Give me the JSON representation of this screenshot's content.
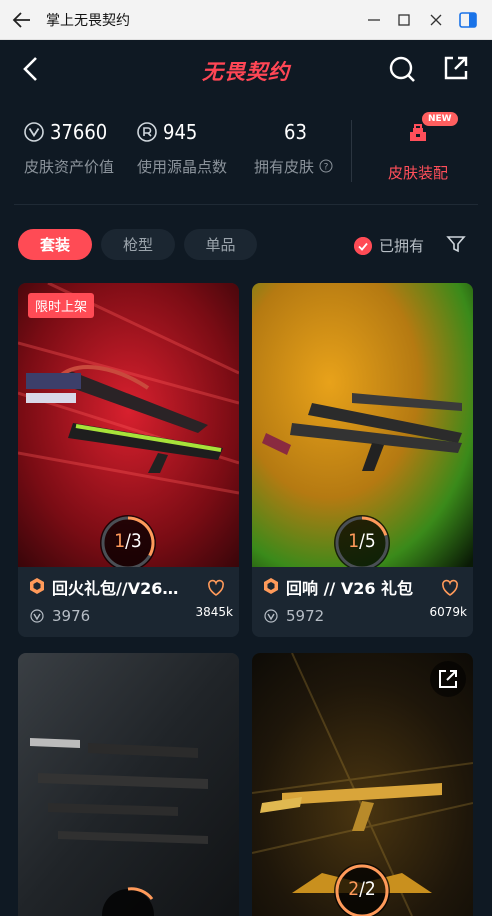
{
  "window": {
    "title": "掌上无畏契约"
  },
  "header": {
    "logo_text": "无畏契约"
  },
  "stats": [
    {
      "value": "37660",
      "label": "皮肤资产价值"
    },
    {
      "value": "945",
      "label": "使用源晶点数"
    },
    {
      "value": "63",
      "label": "拥有皮肤"
    }
  ],
  "equip": {
    "label": "皮肤装配",
    "badge": "NEW"
  },
  "tabs": [
    "套装",
    "枪型",
    "单品"
  ],
  "owned_filter": "已拥有",
  "cards": [
    {
      "flag": "限时上架",
      "name": "回火礼包//V26…",
      "price": "3976",
      "likes": "3845k",
      "progress_current": "1",
      "progress_total": "3"
    },
    {
      "name": "回响 // V26 礼包",
      "price": "5972",
      "likes": "6079k",
      "progress_current": "1",
      "progress_total": "5"
    },
    {
      "name": "",
      "progress_current": "",
      "progress_total": ""
    },
    {
      "name": "",
      "progress_current": "2",
      "progress_total": "2"
    }
  ],
  "colors": {
    "accent": "#ff4b55",
    "bg": "#0f1923",
    "card": "#1b2631",
    "progress": "#ff9a5a"
  }
}
